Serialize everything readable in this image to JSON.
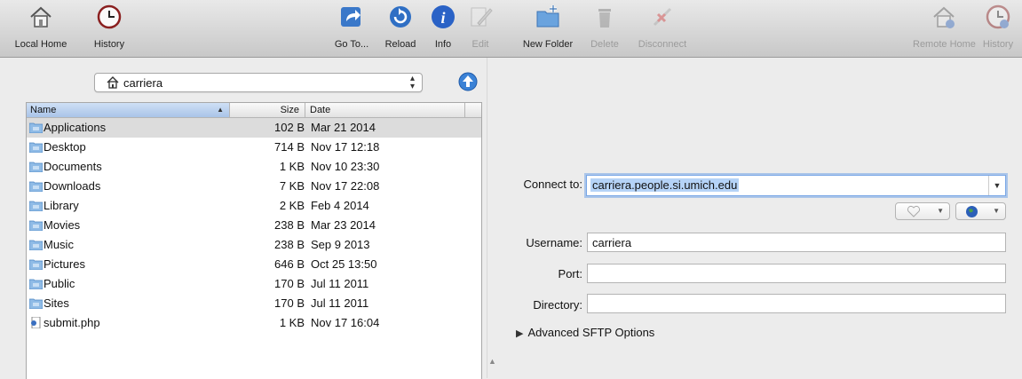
{
  "toolbar": {
    "local_home": "Local Home",
    "history": "History",
    "go_to": "Go To...",
    "reload": "Reload",
    "info": "Info",
    "edit": "Edit",
    "new_folder": "New Folder",
    "delete": "Delete",
    "disconnect": "Disconnect",
    "remote_home": "Remote Home",
    "remote_history": "History"
  },
  "local": {
    "path": "carriera",
    "columns": {
      "name": "Name",
      "size": "Size",
      "date": "Date"
    },
    "files": [
      {
        "name": "Applications",
        "size": "102 B",
        "date": "Mar 21 2014",
        "icon": "applications-folder-icon",
        "selected": true
      },
      {
        "name": "Desktop",
        "size": "714 B",
        "date": "Nov 17 12:18",
        "icon": "desktop-folder-icon"
      },
      {
        "name": "Documents",
        "size": "1 KB",
        "date": "Nov 10 23:30",
        "icon": "documents-folder-icon"
      },
      {
        "name": "Downloads",
        "size": "7 KB",
        "date": "Nov 17 22:08",
        "icon": "downloads-folder-icon"
      },
      {
        "name": "Library",
        "size": "2 KB",
        "date": "Feb 4 2014",
        "icon": "library-folder-icon"
      },
      {
        "name": "Movies",
        "size": "238 B",
        "date": "Mar 23 2014",
        "icon": "movies-folder-icon"
      },
      {
        "name": "Music",
        "size": "238 B",
        "date": "Sep 9 2013",
        "icon": "music-folder-icon"
      },
      {
        "name": "Pictures",
        "size": "646 B",
        "date": "Oct 25 13:50",
        "icon": "pictures-folder-icon"
      },
      {
        "name": "Public",
        "size": "170 B",
        "date": "Jul 11 2011",
        "icon": "public-folder-icon"
      },
      {
        "name": "Sites",
        "size": "170 B",
        "date": "Jul 11 2011",
        "icon": "sites-folder-icon"
      },
      {
        "name": "submit.php",
        "size": "1 KB",
        "date": "Nov 17 16:04",
        "icon": "php-file-icon"
      }
    ]
  },
  "connect": {
    "connect_label": "Connect to:",
    "host": "carriera.people.si.umich.edu",
    "username_label": "Username:",
    "username": "carriera",
    "port_label": "Port:",
    "port": "",
    "directory_label": "Directory:",
    "directory": "",
    "advanced": "Advanced SFTP Options"
  },
  "colors": {
    "accent": "#2f7fd6",
    "selection": "#b5d3f7",
    "row_selected": "#dcdcdc"
  }
}
